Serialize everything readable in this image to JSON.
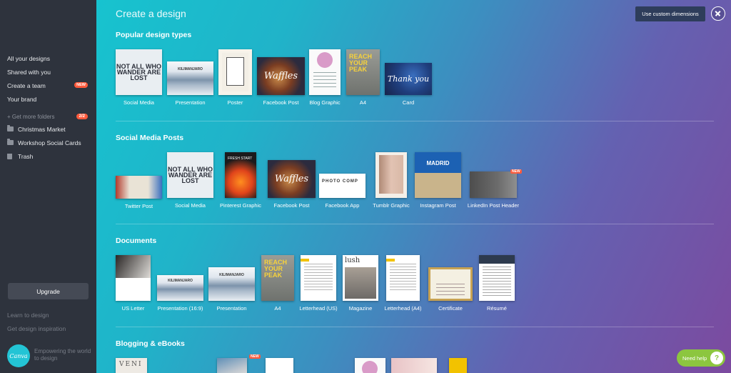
{
  "sidebar": {
    "nav": [
      {
        "label": "All your designs"
      },
      {
        "label": "Shared with you"
      },
      {
        "label": "Create a team",
        "badge": "NEW"
      },
      {
        "label": "Your brand"
      }
    ],
    "folders_label": "+ Get more folders",
    "folders_count": "2/2",
    "folders": [
      {
        "label": "Christmas Market"
      },
      {
        "label": "Workshop Social Cards"
      }
    ],
    "trash_label": "Trash",
    "upgrade_label": "Upgrade",
    "learn_label": "Learn to design",
    "inspiration_label": "Get design inspiration",
    "logo_text": "Canva",
    "tagline": "Empowering the world to design"
  },
  "main": {
    "title": "Create a design",
    "custom_dimensions_label": "Use custom dimensions",
    "sections": [
      {
        "title": "Popular design types",
        "items": [
          {
            "label": "Social Media",
            "thumb_text": "NOT ALL WHO WANDER ARE LOST"
          },
          {
            "label": "Presentation",
            "thumb_text": "KILIMANJARO"
          },
          {
            "label": "Poster"
          },
          {
            "label": "Facebook Post",
            "thumb_text": "Waffles"
          },
          {
            "label": "Blog Graphic"
          },
          {
            "label": "A4",
            "thumb_text": "REACH YOUR PEAK"
          },
          {
            "label": "Card",
            "thumb_text": "Thank you"
          }
        ]
      },
      {
        "title": "Social Media Posts",
        "items": [
          {
            "label": "Twitter Post"
          },
          {
            "label": "Social Media",
            "thumb_text": "NOT ALL WHO WANDER ARE LOST"
          },
          {
            "label": "Pinterest Graphic",
            "thumb_text": "FRESH START"
          },
          {
            "label": "Facebook Post",
            "thumb_text": "Waffles"
          },
          {
            "label": "Facebook App",
            "thumb_text": "PHOTO COMP"
          },
          {
            "label": "Tumblr Graphic"
          },
          {
            "label": "Instagram Post",
            "thumb_text": "MADRID"
          },
          {
            "label": "LinkedIn Post Header",
            "badge": "NEW"
          }
        ]
      },
      {
        "title": "Documents",
        "items": [
          {
            "label": "US Letter"
          },
          {
            "label": "Presentation (16:9)",
            "thumb_text": "KILIMANJARO"
          },
          {
            "label": "Presentation",
            "thumb_text": "KILIMANJARO"
          },
          {
            "label": "A4",
            "thumb_text": "REACH YOUR PEAK"
          },
          {
            "label": "Letterhead (US)"
          },
          {
            "label": "Magazine",
            "thumb_text": "lush"
          },
          {
            "label": "Letterhead (A4)"
          },
          {
            "label": "Certificate"
          },
          {
            "label": "Résumé"
          }
        ]
      },
      {
        "title": "Blogging & eBooks",
        "items": [
          {
            "thumb_text": "VENI"
          },
          {
            "badge": "NEW"
          },
          {},
          {},
          {},
          {}
        ]
      }
    ]
  },
  "help_label": "Need help",
  "help_icon": "?",
  "colors": {
    "sidebar_bg": "#2e333d",
    "accent_orange": "#ff5a3c",
    "gradient_start": "#17c3cf",
    "gradient_end": "#7c4a9f",
    "help_green": "#8cc63f"
  }
}
